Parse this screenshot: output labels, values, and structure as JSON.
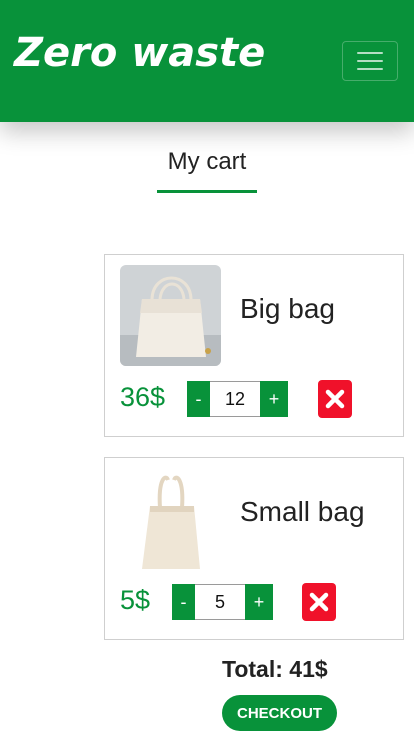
{
  "brand": {
    "name": "Zero waste"
  },
  "colors": {
    "primary": "#08923a",
    "danger": "#f0112a"
  },
  "nav": {
    "menu_icon": "hamburger-menu-icon"
  },
  "tab": {
    "label": "My cart"
  },
  "cart": {
    "items": [
      {
        "name": "Big bag",
        "price": "36$",
        "quantity": "12",
        "minus": "-",
        "plus": "+",
        "image_icon": "tote-bag-image",
        "remove_icon": "close-x-icon"
      },
      {
        "name": "Small bag",
        "price": "5$",
        "quantity": "5",
        "minus": "-",
        "plus": "+",
        "image_icon": "small-bag-image",
        "remove_icon": "close-x-icon"
      }
    ],
    "total_label": "Total: 41$",
    "checkout_label": "CHECKOUT"
  }
}
